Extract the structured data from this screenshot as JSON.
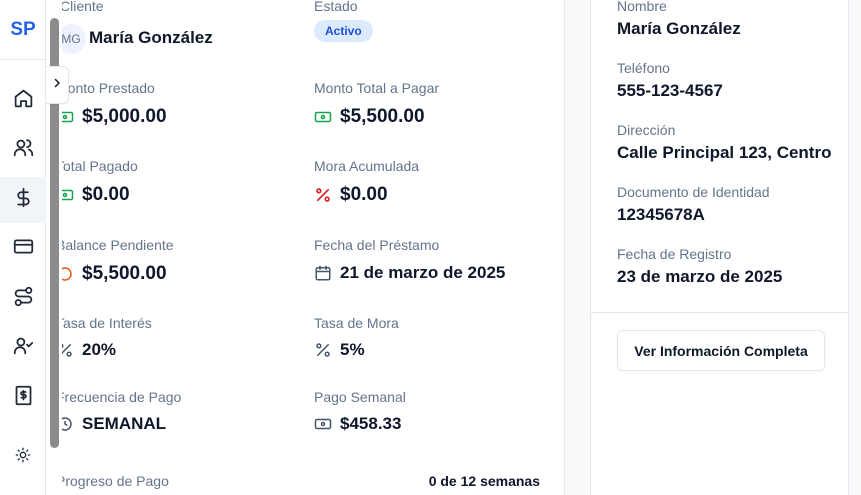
{
  "sidebar": {
    "logo": "SP",
    "items": [
      {
        "icon": "home-icon",
        "active": false
      },
      {
        "icon": "users-icon",
        "active": false
      },
      {
        "icon": "dollar-icon",
        "active": true
      },
      {
        "icon": "credit-card-icon",
        "active": false
      },
      {
        "icon": "route-icon",
        "active": false
      },
      {
        "icon": "user-check-icon",
        "active": false
      },
      {
        "icon": "receipt-icon",
        "active": false
      },
      {
        "icon": "sun-icon",
        "active": false
      }
    ]
  },
  "loan": {
    "client_label": "Cliente",
    "client_initials": "MG",
    "client_name": "María González",
    "status_label": "Estado",
    "status": "Activo",
    "amount_lent_label": "Monto Prestado",
    "amount_lent": "$5,000.00",
    "total_to_pay_label": "Monto Total a Pagar",
    "total_to_pay": "$5,500.00",
    "total_paid_label": "Total Pagado",
    "total_paid": "$0.00",
    "late_fee_accum_label": "Mora Acumulada",
    "late_fee_accum": "$0.00",
    "balance_label": "Balance Pendiente",
    "balance": "$5,500.00",
    "loan_date_label": "Fecha del Préstamo",
    "loan_date": "21 de marzo de 2025",
    "interest_rate_label": "Tasa de Interés",
    "interest_rate": "20%",
    "late_rate_label": "Tasa de Mora",
    "late_rate": "5%",
    "frequency_label": "Frecuencia de Pago",
    "frequency": "SEMANAL",
    "weekly_payment_label": "Pago Semanal",
    "weekly_payment": "$458.33",
    "progress_label": "Progreso de Pago",
    "progress_count": "0 de 12 semanas"
  },
  "client_info": {
    "name_label": "Nombre",
    "name": "María González",
    "phone_label": "Teléfono",
    "phone": "555-123-4567",
    "address_label": "Dirección",
    "address": "Calle Principal 123, Centro",
    "id_doc_label": "Documento de Identidad",
    "id_doc": "12345678A",
    "registered_label": "Fecha de Registro",
    "registered": "23 de marzo de 2025",
    "full_info_button": "Ver Información Completa"
  },
  "colors": {
    "accent": "#2563eb",
    "badge_bg": "#dbeafe",
    "money_green": "#16a34a",
    "percent_red": "#dc2626"
  }
}
